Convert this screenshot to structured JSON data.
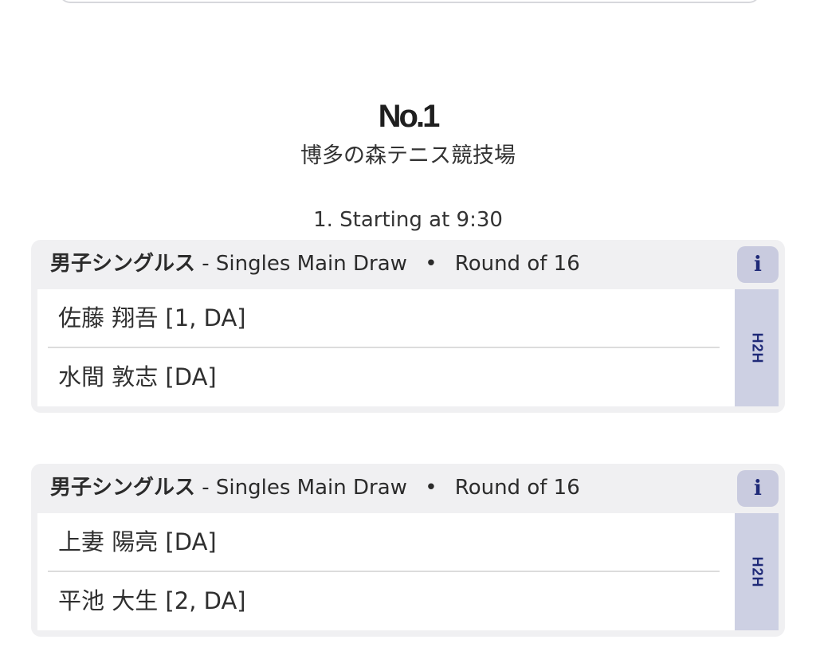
{
  "court": {
    "number": "No.1",
    "venue": "博多の森テニス競技場"
  },
  "schedule": {
    "start_time": "1. Starting at 9:30"
  },
  "matches": [
    {
      "event": "男子シングルス",
      "draw": "- Singles Main Draw",
      "separator": "•",
      "round": "Round of 16",
      "info_icon": "i",
      "h2h_label": "H2H",
      "players": [
        "佐藤 翔吾 [1, DA]",
        "水間 敦志 [DA]"
      ]
    },
    {
      "event": "男子シングルス",
      "draw": "- Singles Main Draw",
      "separator": "•",
      "round": "Round of 16",
      "info_icon": "i",
      "h2h_label": "H2H",
      "players": [
        "上妻 陽亮 [DA]",
        "平池 大生 [2, DA]"
      ]
    }
  ],
  "colors": {
    "card_bg": "#f0f0f2",
    "accent_blue": "#1f2a78",
    "h2h_bg": "#cdd0e3",
    "info_bg": "#c9cbdf"
  }
}
